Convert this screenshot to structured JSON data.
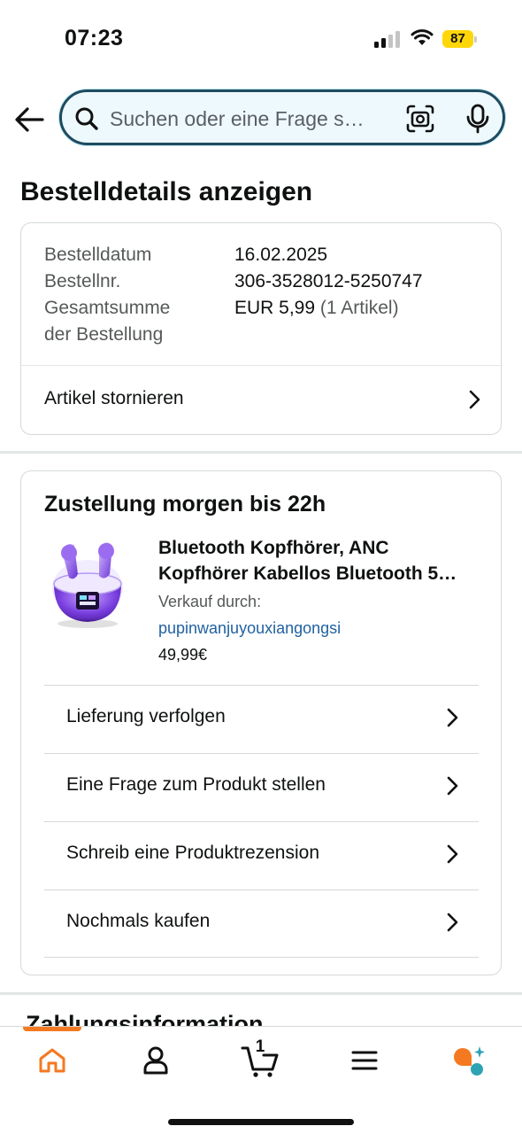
{
  "status_bar": {
    "time": "07:23",
    "battery": "87"
  },
  "search": {
    "placeholder": "Suchen oder eine Frage s…"
  },
  "page_title": "Bestelldetails anzeigen",
  "order": {
    "date_label": "Bestelldatum",
    "date_value": "16.02.2025",
    "number_label": "Bestellnr.",
    "number_value": "306-3528012-5250747",
    "total_label_line1": "Gesamtsumme",
    "total_label_line2": "der Bestellung",
    "total_value": "EUR 5,99",
    "total_items": "(1 Artikel)",
    "cancel_label": "Artikel stornieren"
  },
  "delivery": {
    "title": "Zustellung morgen bis 22h",
    "product": {
      "title_line1": "Bluetooth Kopfhörer, ANC",
      "title_line2": "Kopfhörer Kabellos Bluetooth 5…",
      "seller_label": "Verkauf durch:",
      "seller_name": "pupinwanjuyouxiangongsi",
      "price": "49,99€"
    },
    "actions": [
      {
        "label": "Lieferung verfolgen"
      },
      {
        "label": "Eine Frage zum Produkt stellen"
      },
      {
        "label": "Schreib eine Produktrezension"
      },
      {
        "label": "Nochmals kaufen"
      }
    ]
  },
  "payment_heading": "Zahlungsinformation",
  "bottom_nav": {
    "cart_count": "1",
    "items": [
      "home-icon",
      "account-icon",
      "cart-icon",
      "menu-icon",
      "rufus-assistant-icon"
    ],
    "active_color": "#f47920"
  }
}
